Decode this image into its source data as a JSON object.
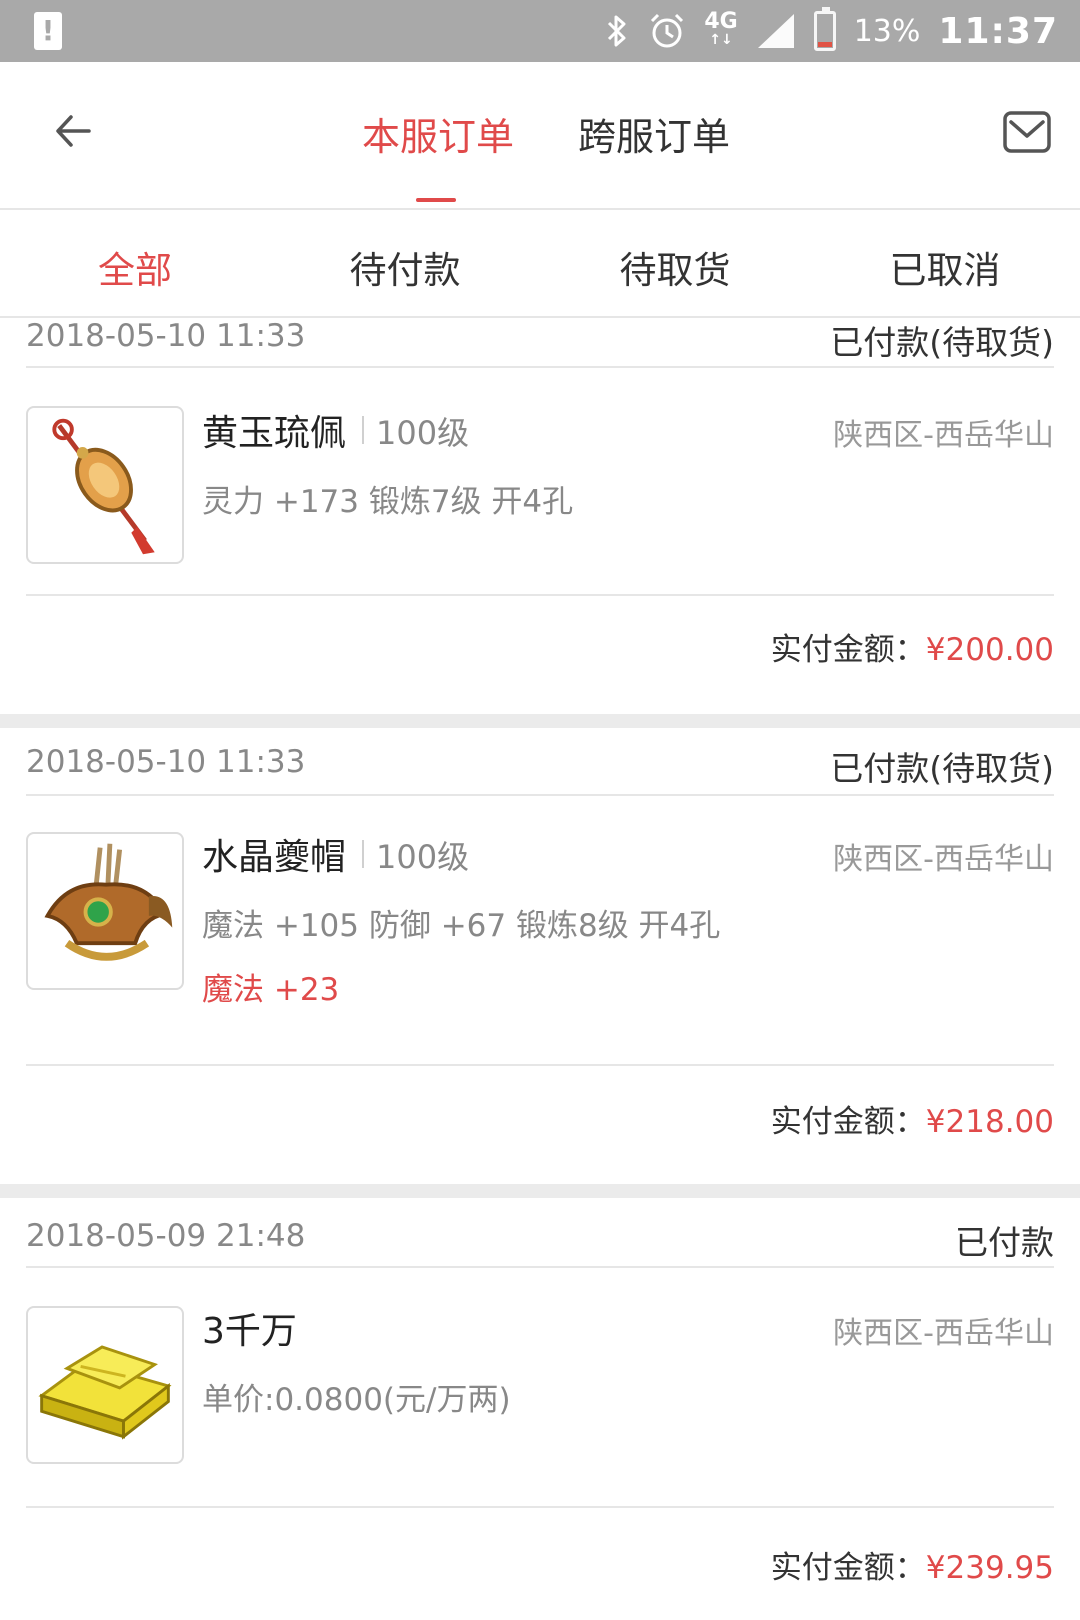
{
  "status_bar": {
    "battery_percent": "13%",
    "time": "11:37",
    "network": "4G",
    "icons": [
      "alert-icon",
      "bluetooth-icon",
      "alarm-icon",
      "4g-icon",
      "signal-icon",
      "battery-icon"
    ]
  },
  "header": {
    "tabs": [
      {
        "label": "本服订单",
        "active": true
      },
      {
        "label": "跨服订单",
        "active": false
      }
    ]
  },
  "filters": [
    {
      "label": "全部",
      "active": true
    },
    {
      "label": "待付款",
      "active": false
    },
    {
      "label": "待取货",
      "active": false
    },
    {
      "label": "已取消",
      "active": false
    }
  ],
  "orders": [
    {
      "date": "2018-05-10 11:33",
      "status": "已付款(待取货)",
      "name": "黄玉琉佩",
      "level": "100级",
      "server": "陕西区-西岳华山",
      "attrs": "灵力 +173 锻炼7级 开4孔",
      "extra": "",
      "pay_label": "实付金额：",
      "pay_amount": "¥200.00"
    },
    {
      "date": "2018-05-10 11:33",
      "status": "已付款(待取货)",
      "name": "水晶夔帽",
      "level": "100级",
      "server": "陕西区-西岳华山",
      "attrs": "魔法 +105 防御 +67 锻炼8级 开4孔",
      "extra": "魔法 +23",
      "pay_label": "实付金额：",
      "pay_amount": "¥218.00"
    },
    {
      "date": "2018-05-09 21:48",
      "status": "已付款",
      "name": "3千万",
      "level": "",
      "server": "陕西区-西岳华山",
      "attrs": "单价:0.0800(元/万两)",
      "extra": "",
      "pay_label": "实付金额：",
      "pay_amount": "¥239.95"
    }
  ],
  "colors": {
    "accent": "#e04a4a",
    "status_bar": "#a9a9a9",
    "divider": "#e6e6e6",
    "muted_text": "#888888"
  }
}
